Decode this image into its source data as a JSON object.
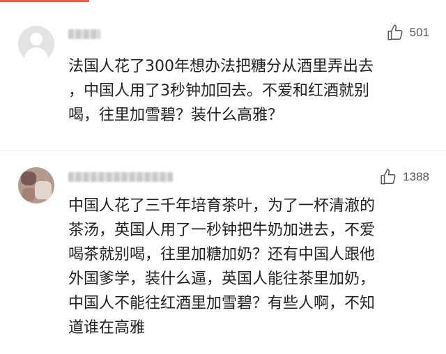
{
  "comments": [
    {
      "likes": "501",
      "text": "法国人花了300年想办法把糖分从酒里弄出去\n，中国人用了3秒钟加回去。不爱和红酒就别\n喝，往里加雪碧？装什么高雅？"
    },
    {
      "likes": "1388",
      "text": "中国人花了三千年培育茶叶，为了一杯清澈的\n茶汤，英国人用了一秒钟把牛奶加进去，不爱\n喝茶就别喝，往里加糖加奶？还有中国人跟他\n外国爹学，装什么逼，英国人能往茶里加奶，\n中国人不能往红酒里加雪碧？有些人啊，不知\n道谁在高雅"
    }
  ],
  "colors": {
    "accent": "#e8614d",
    "text": "#222222",
    "count": "#555555"
  },
  "icons": {
    "like": "thumbs-up-outline-icon",
    "default_avatar": "person-silhouette-icon"
  }
}
